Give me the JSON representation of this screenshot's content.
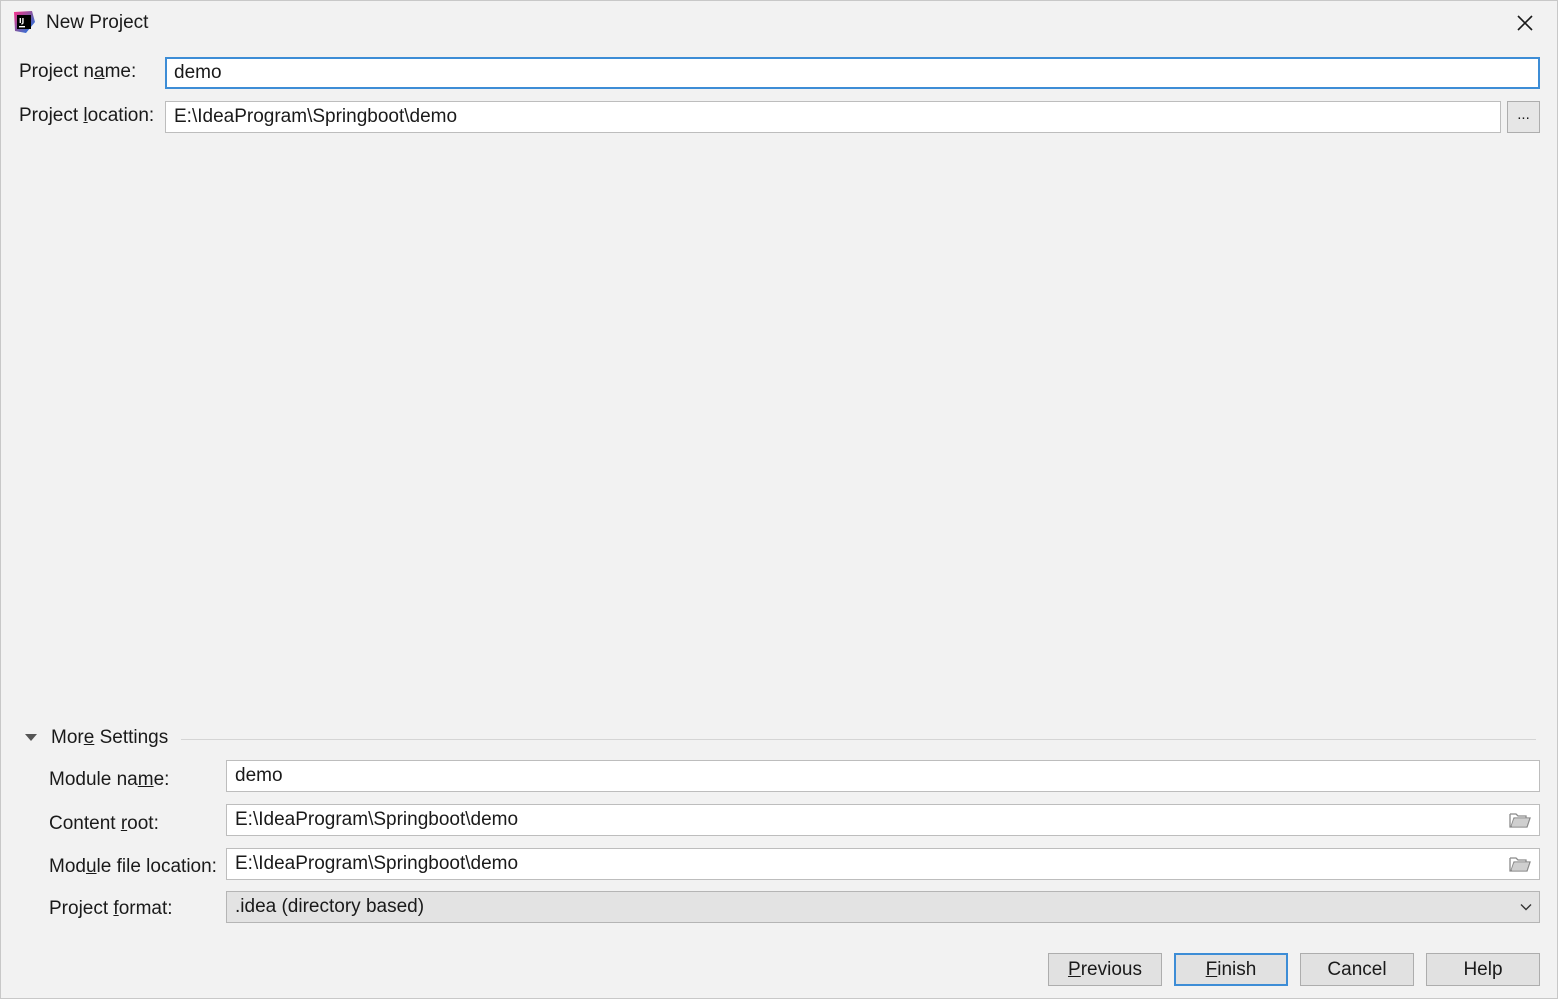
{
  "window": {
    "title": "New Project",
    "app_icon": "intellij-idea-icon",
    "close_icon": "close-icon"
  },
  "form": {
    "project_name": {
      "label_pre": "Project n",
      "label_mnemonic": "a",
      "label_post": "me:",
      "value": "demo"
    },
    "project_location": {
      "label_pre": "Project ",
      "label_mnemonic": "l",
      "label_post": "ocation:",
      "value": "E:\\IdeaProgram\\Springboot\\demo",
      "browse_label": "..."
    }
  },
  "more_settings": {
    "title_pre": "Mor",
    "title_mnemonic": "e",
    "title_post": " Settings",
    "expanded": true,
    "module_name": {
      "label_pre": "Module na",
      "label_mnemonic": "m",
      "label_post": "e:",
      "value": "demo"
    },
    "content_root": {
      "label_pre": "Content ",
      "label_mnemonic": "r",
      "label_post": "oot:",
      "value": "E:\\IdeaProgram\\Springboot\\demo"
    },
    "module_file_location": {
      "label_pre": "Mod",
      "label_mnemonic": "u",
      "label_post": "le file location:",
      "value": "E:\\IdeaProgram\\Springboot\\demo"
    },
    "project_format": {
      "label_pre": "Project ",
      "label_mnemonic": "f",
      "label_post": "ormat:",
      "selected": ".idea (directory based)"
    }
  },
  "buttons": {
    "previous": {
      "mnemonic": "P",
      "rest": "revious"
    },
    "finish": {
      "mnemonic": "F",
      "rest": "inish"
    },
    "cancel": {
      "label": "Cancel"
    },
    "help": {
      "label": "Help"
    }
  },
  "colors": {
    "background": "#f2f2f2",
    "focus_border": "#3d8dd6",
    "field_background": "#ffffff",
    "button_background": "#e1e1e1"
  }
}
